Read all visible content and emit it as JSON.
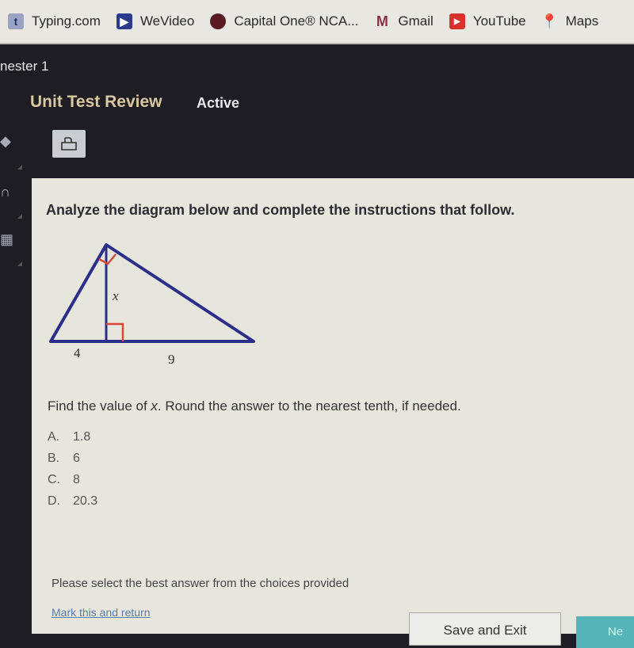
{
  "bookmarks": [
    {
      "label": "Typing.com",
      "icon": "typing-icon"
    },
    {
      "label": "WeVideo",
      "icon": "wevideo-icon"
    },
    {
      "label": "Capital One® NCA...",
      "icon": "capital-one-icon"
    },
    {
      "label": "Gmail",
      "icon": "gmail-icon"
    },
    {
      "label": "YouTube",
      "icon": "youtube-icon"
    },
    {
      "label": "Maps",
      "icon": "maps-icon"
    }
  ],
  "breadcrumb": "nester 1",
  "header": {
    "title": "Unit Test Review",
    "status": "Active"
  },
  "toolbar": {
    "print_icon": "print-icon"
  },
  "question": {
    "instruction": "Analyze the diagram below and complete the instructions that follow.",
    "diagram": {
      "label_x": "x",
      "label_left": "4",
      "label_right": "9"
    },
    "prompt_before": "Find the value of ",
    "prompt_var": "x",
    "prompt_after": ". Round the answer to the nearest tenth, if needed.",
    "choices": [
      {
        "letter": "A.",
        "value": "1.8"
      },
      {
        "letter": "B.",
        "value": "6"
      },
      {
        "letter": "C.",
        "value": "8"
      },
      {
        "letter": "D.",
        "value": "20.3"
      }
    ]
  },
  "footer": {
    "help": "Please select the best answer from the choices provided",
    "mark_link": "Mark this and return",
    "save_button": "Save and Exit",
    "next_button": "Ne"
  }
}
